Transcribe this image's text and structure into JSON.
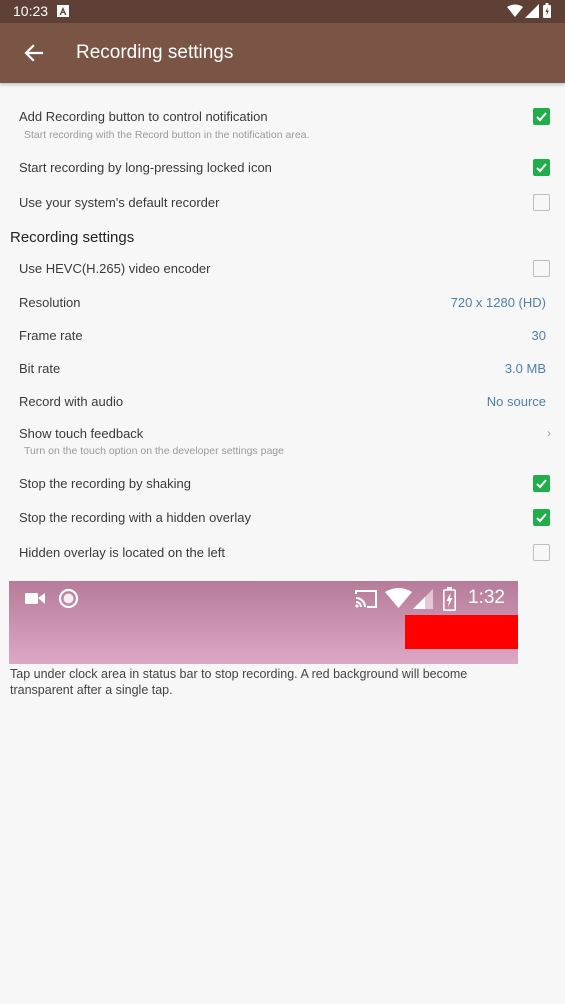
{
  "status_bar": {
    "time": "10:23",
    "icons": [
      "a-notification-icon",
      "wifi-icon",
      "signal-icon",
      "battery-icon"
    ]
  },
  "app_bar": {
    "title": "Recording settings",
    "background": "#7a5546"
  },
  "general": [
    {
      "label": "Add Recording button to control notification",
      "sub": "Start recording with the Record button in the notification area.",
      "checked": true
    },
    {
      "label": "Start recording by long-pressing locked icon",
      "checked": true
    },
    {
      "label": "Use your system's default recorder",
      "checked": false
    }
  ],
  "section_title": "Recording settings",
  "recording": {
    "hevc": {
      "label": "Use HEVC(H.265) video encoder",
      "checked": false
    },
    "resolution": {
      "label": "Resolution",
      "value": "720 x 1280 (HD)"
    },
    "frame_rate": {
      "label": "Frame rate",
      "value": "30"
    },
    "bit_rate": {
      "label": "Bit rate",
      "value": "3.0 MB"
    },
    "audio": {
      "label": "Record with audio",
      "value": "No source"
    },
    "touch": {
      "label": "Show touch feedback",
      "sub": "Turn on the touch option on the developer settings page"
    },
    "shaking": {
      "label": "Stop the recording by shaking",
      "checked": true
    },
    "hidden_overlay": {
      "label": "Stop the recording with a hidden overlay",
      "checked": true
    },
    "overlay_left": {
      "label": "Hidden overlay is located on the left",
      "checked": false
    }
  },
  "preview": {
    "time": "1:32",
    "icons": [
      "video-camera-icon",
      "record-circle-icon",
      "cast-icon",
      "wifi-icon",
      "signal-icon",
      "battery-charging-icon"
    ]
  },
  "caption": "Tap under clock area in status bar to stop recording. A red background will become transparent after a single tap.",
  "colors": {
    "accent_value": "#4d7fb5",
    "checkbox_on": "#1fae4a",
    "status_bar": "#5e4036"
  }
}
